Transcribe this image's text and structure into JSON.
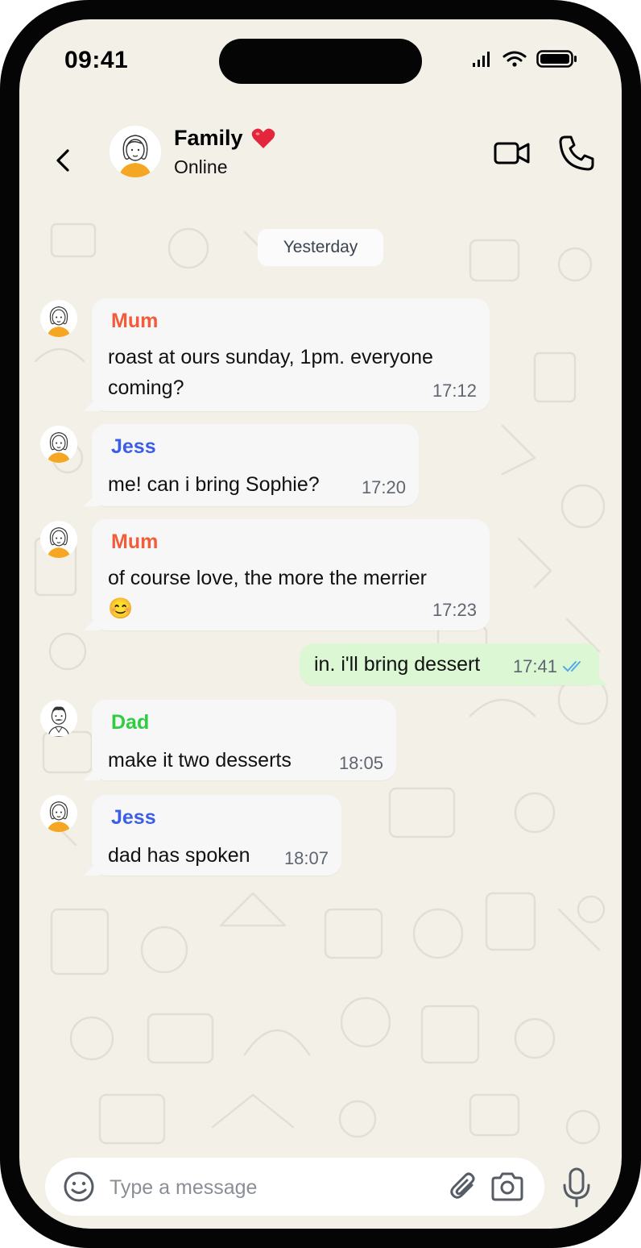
{
  "status_bar": {
    "time": "09:41"
  },
  "header": {
    "title": "Family",
    "title_emoji": "❤️",
    "subtitle": "Online"
  },
  "date_divider": "Yesterday",
  "colors": {
    "mum": "#f25c3a",
    "jess": "#3b5ee6",
    "dad": "#2ecc40",
    "outgoing_bubble": "#dcf7d4",
    "incoming_bubble": "#f7f7f7",
    "read_ticks": "#53a9e6",
    "background": "#f3f0e8"
  },
  "messages": [
    {
      "sender": "Mum",
      "lines": [
        "roast at ours sunday, 1pm. everyone",
        "coming?"
      ],
      "time": "17:12"
    },
    {
      "sender": "Jess",
      "lines": [
        "me! can i bring Sophie?"
      ],
      "time": "17:20"
    },
    {
      "sender": "Mum",
      "lines": [
        "of course love, the more the merrier",
        "😊"
      ],
      "time": "17:23"
    },
    {
      "sender": "me",
      "lines": [
        "in. i'll bring dessert"
      ],
      "time": "17:41",
      "status": "read"
    },
    {
      "sender": "Dad",
      "lines": [
        "make it two desserts"
      ],
      "time": "18:05"
    },
    {
      "sender": "Jess",
      "lines": [
        "dad has spoken"
      ],
      "time": "18:07"
    }
  ],
  "composer": {
    "placeholder": "Type a message"
  },
  "icons": [
    "back-icon",
    "video-call-icon",
    "phone-call-icon",
    "emoji-icon",
    "attach-icon",
    "camera-icon",
    "microphone-icon",
    "double-check-icon",
    "signal-icon",
    "wifi-icon",
    "battery-icon"
  ]
}
